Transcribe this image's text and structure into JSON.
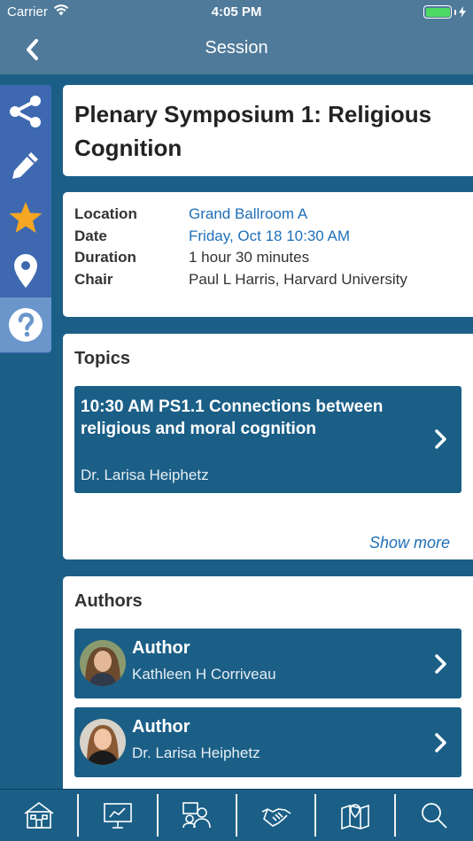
{
  "status_bar": {
    "carrier": "Carrier",
    "time": "4:05 PM"
  },
  "nav": {
    "title": "Session",
    "back_icon": "chevron-left-icon"
  },
  "side_toolbar": {
    "items": [
      {
        "icon": "share-icon"
      },
      {
        "icon": "pencil-icon"
      },
      {
        "icon": "star-icon",
        "color": "#f5a623"
      },
      {
        "icon": "location-pin-icon"
      },
      {
        "icon": "help-icon"
      }
    ]
  },
  "session": {
    "title": "Plenary Symposium 1: Religious Cognition",
    "details": {
      "location_label": "Location",
      "location_value": "Grand Ballroom A",
      "date_label": "Date",
      "date_value": "Friday, Oct 18 10:30 AM",
      "duration_label": "Duration",
      "duration_value": "1 hour 30 minutes",
      "chair_label": "Chair",
      "chair_value": "Paul L Harris, Harvard University"
    }
  },
  "topics": {
    "heading": "Topics",
    "items": [
      {
        "title": "10:30 AM  PS1.1 Connections between religious and moral cognition",
        "speaker": "Dr. Larisa Heiphetz"
      }
    ],
    "show_more": "Show more"
  },
  "authors": {
    "heading": "Authors",
    "items": [
      {
        "role": "Author",
        "name": "Kathleen H Corriveau"
      },
      {
        "role": "Author",
        "name": "Dr. Larisa Heiphetz"
      }
    ]
  },
  "tab_bar": {
    "items": [
      {
        "icon": "home-icon"
      },
      {
        "icon": "presentation-icon"
      },
      {
        "icon": "people-icon"
      },
      {
        "icon": "handshake-icon"
      },
      {
        "icon": "map-icon"
      },
      {
        "icon": "search-icon"
      }
    ]
  },
  "colors": {
    "accent": "#1b5f87",
    "nav": "#4f7a9a",
    "toolbar": "#3e69b0",
    "link": "#1f6fb8",
    "star": "#f5a623"
  }
}
